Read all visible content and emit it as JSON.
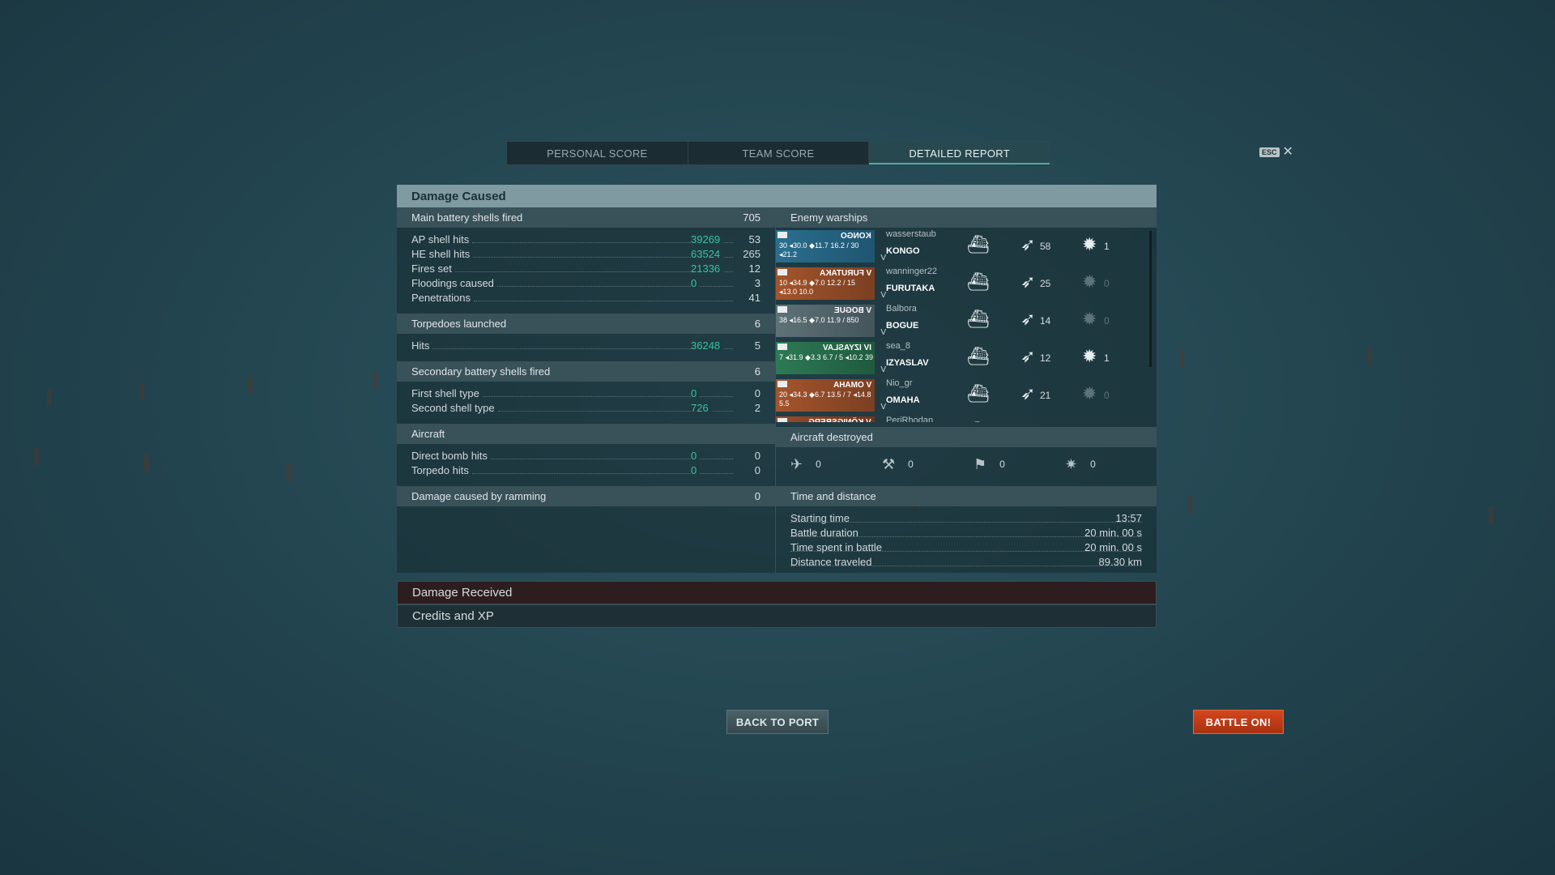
{
  "tabs": [
    {
      "label": "PERSONAL SCORE"
    },
    {
      "label": "TEAM SCORE"
    },
    {
      "label": "DETAILED REPORT"
    }
  ],
  "esc_label": "ESC",
  "close_glyph": "✕",
  "damage_caused": {
    "title": "Damage Caused",
    "main_battery": {
      "label": "Main battery shells fired",
      "count": "705",
      "rows": [
        {
          "label": "AP shell hits",
          "damage": "39269",
          "count": "53"
        },
        {
          "label": "HE shell hits",
          "damage": "63524",
          "count": "265"
        },
        {
          "label": "Fires set",
          "damage": "21336",
          "count": "12"
        },
        {
          "label": "Floodings caused",
          "damage": "0",
          "count": "3"
        },
        {
          "label": "Penetrations",
          "damage": "",
          "count": "41"
        }
      ]
    },
    "torpedoes": {
      "label": "Torpedoes launched",
      "count": "6",
      "rows": [
        {
          "label": "Hits",
          "damage": "36248",
          "count": "5"
        }
      ]
    },
    "secondary": {
      "label": "Secondary battery shells fired",
      "count": "6",
      "rows": [
        {
          "label": "First shell type",
          "damage": "0",
          "count": "0"
        },
        {
          "label": "Second shell type",
          "damage": "726",
          "count": "2"
        }
      ]
    },
    "aircraft": {
      "label": "Aircraft",
      "rows": [
        {
          "label": "Direct bomb hits",
          "damage": "0",
          "count": "0"
        },
        {
          "label": "Torpedo hits",
          "damage": "0",
          "count": "0"
        }
      ]
    },
    "ramming": {
      "label": "Damage caused by ramming",
      "count": "0"
    }
  },
  "enemy_warships": {
    "title": "Enemy warships",
    "ships": [
      {
        "player": "wasserstaub",
        "ship": "KONGO",
        "tier": "V",
        "card_name": "KONGO",
        "stats": "30 ◂30.0 ◆11.7 16.2 / 30 ◂21.2",
        "hits": "58",
        "kills": "1",
        "kills_dim": false,
        "color": "blue"
      },
      {
        "player": "wanninger22",
        "ship": "FURUTAKA",
        "tier": "V",
        "card_name": "V FURUTAKA",
        "stats": "10 ◂34.9 ◆7.0 12.2 / 15 ◂13.0 10.0",
        "hits": "25",
        "kills": "0",
        "kills_dim": true,
        "color": "orange"
      },
      {
        "player": "Balbora",
        "ship": "BOGUE",
        "tier": "V",
        "card_name": "V BOGUE",
        "stats": "38 ◂16.5 ◆7.0 11.9 / 850",
        "hits": "14",
        "kills": "0",
        "kills_dim": true,
        "color": "grey"
      },
      {
        "player": "sea_8",
        "ship": "IZYASLAV",
        "tier": "V",
        "card_name": "IV IZYASLAV",
        "stats": "7 ◂31.9 ◆3.3 6.7 / 5 ◂10.2 39",
        "hits": "12",
        "kills": "1",
        "kills_dim": false,
        "color": "green"
      },
      {
        "player": "Nio_gr",
        "ship": "OMAHA",
        "tier": "V",
        "card_name": "V OMAHA",
        "stats": "20 ◂34.3 ◆6.7 13.5 / 7 ◂14.8 5.5",
        "hits": "21",
        "kills": "0",
        "kills_dim": true,
        "color": "orange"
      },
      {
        "player": "PeriRhodan",
        "ship": "KÖNIGSBERG",
        "tier": "V",
        "card_name": "V KÖNIGSBERG",
        "stats": "",
        "hits": "",
        "kills": "",
        "kills_dim": true,
        "color": "red"
      }
    ]
  },
  "aircraft_destroyed": {
    "title": "Aircraft destroyed",
    "items": [
      {
        "icon": "fighter-icon",
        "glyph": "✈",
        "value": "0"
      },
      {
        "icon": "bomber-icon",
        "glyph": "⚒",
        "value": "0"
      },
      {
        "icon": "torpedo-bomber-icon",
        "glyph": "⚑",
        "value": "0"
      },
      {
        "icon": "dive-bomber-icon",
        "glyph": "✷",
        "value": "0"
      }
    ]
  },
  "time_distance": {
    "title": "Time and distance",
    "rows": [
      {
        "label": "Starting time",
        "value": "13:57"
      },
      {
        "label": "Battle duration",
        "value": "20 min. 00 s"
      },
      {
        "label": "Time spent in battle",
        "value": "20 min. 00 s"
      },
      {
        "label": "Distance traveled",
        "value": "89.30 km"
      }
    ]
  },
  "damage_received": "Damage Received",
  "credits_xp": "Credits and XP",
  "buttons": {
    "back": "BACK TO PORT",
    "battle": "BATTLE ON!"
  },
  "colors": {
    "accent": "#37c3a5",
    "battle_button": "#c73d18",
    "header": "#7f9aa0"
  }
}
